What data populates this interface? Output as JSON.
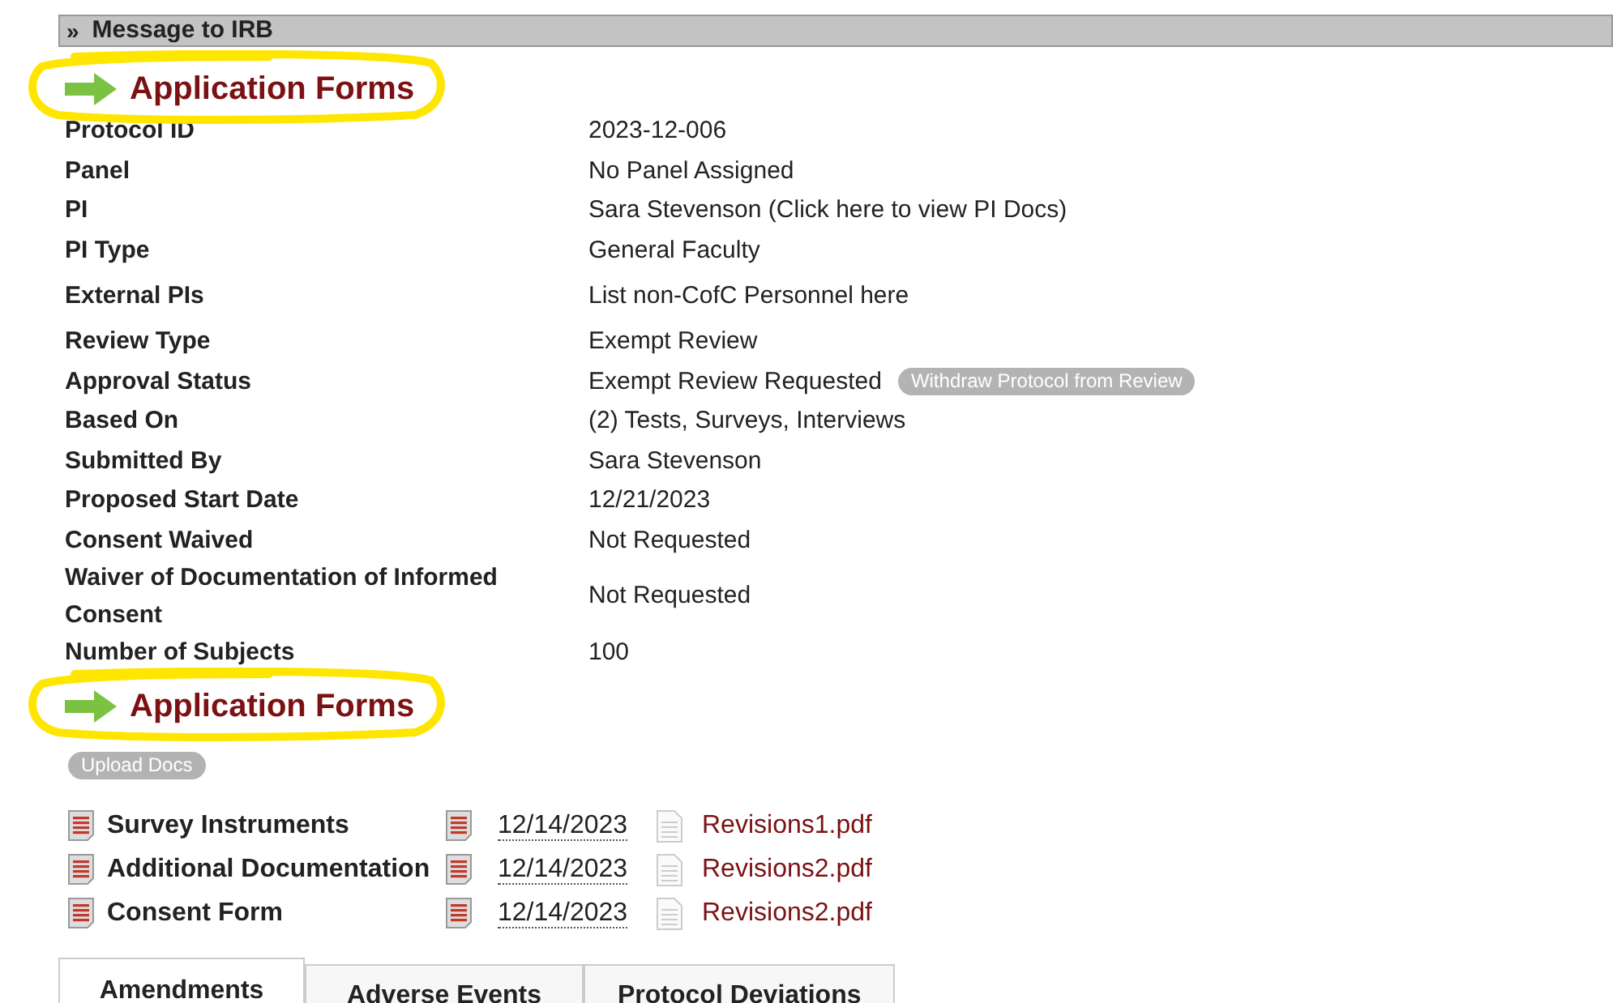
{
  "header": {
    "title": "Message to IRB",
    "icon": "»"
  },
  "details_heading": {
    "title": "Application Forms",
    "highlighted": true
  },
  "fields": [
    {
      "label": "Protocol ID",
      "value": "2023-12-006"
    },
    {
      "label": "Panel",
      "value": "No Panel Assigned"
    },
    {
      "label": "PI",
      "value": "Sara Stevenson (Click here to view PI Docs)"
    },
    {
      "label": "PI Type",
      "value": "General Faculty"
    },
    {
      "label": "External PIs",
      "value": "List non-CofC Personnel here",
      "spaced": true
    },
    {
      "label": "Review Type",
      "value": "Exempt Review"
    },
    {
      "label": "Approval Status",
      "value": "Exempt Review Requested",
      "action": "Withdraw Protocol from Review"
    },
    {
      "label": "Based On",
      "value": "(2) Tests, Surveys, Interviews"
    },
    {
      "label": "Submitted By",
      "value": "Sara Stevenson"
    },
    {
      "label": "Proposed Start Date",
      "value": "12/21/2023"
    },
    {
      "label": "Consent Waived",
      "value": "Not Requested"
    },
    {
      "label": "Waiver of Documentation of Informed Consent",
      "value": "Not Requested"
    },
    {
      "label": "Number of Subjects",
      "value": "100"
    }
  ],
  "forms_heading": {
    "title": "Application Forms",
    "highlighted": true
  },
  "upload_button": "Upload Docs",
  "documents": [
    {
      "name": "Survey Instruments",
      "date": "12/14/2023",
      "file": "Revisions1.pdf"
    },
    {
      "name": "Additional Documentation",
      "date": "12/14/2023",
      "file": "Revisions2.pdf"
    },
    {
      "name": "Consent Form",
      "date": "12/14/2023",
      "file": "Revisions2.pdf"
    }
  ],
  "tabs": [
    {
      "label": "Amendments",
      "selected": true
    },
    {
      "label": "Adverse Events",
      "selected": false
    },
    {
      "label": "Protocol Deviations",
      "selected": false
    }
  ]
}
